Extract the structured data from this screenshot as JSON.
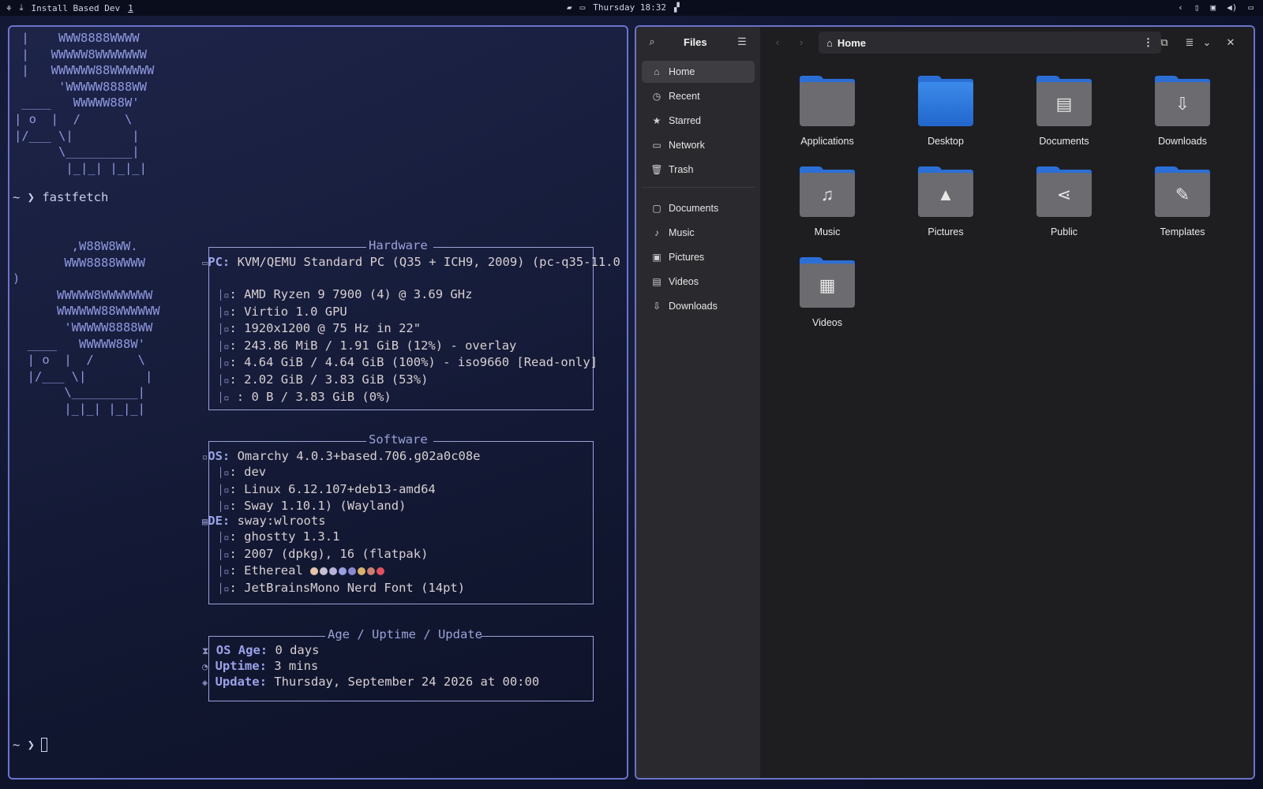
{
  "topbar": {
    "app_title": "Install Based Dev",
    "workspace": "1",
    "clock": "Thursday 18:32"
  },
  "terminal": {
    "top_logo": [
      " |    WWW8888WWWW",
      " |   WWWWW8WWWWWWW",
      " |   WWWWWW88WWWWWW",
      "      'WWWWW8888WW",
      " ____   WWWWW88W'",
      "| o  |  /      \\",
      "|/___ \\|        |",
      "      \\_________|",
      "       |_|_| |_|_|"
    ],
    "prompt_symbol": "~ ❯",
    "command": "fastfetch",
    "logo": [
      "        ,W88W8WW.",
      "       WWW8888WWWW",
      ")",
      "      WWWWW8WWWWWWW",
      "      WWWWWW88WWWWWW",
      "       'WWWWW8888WW",
      "  ____   WWWWW88W'",
      "  | o  |  /      \\",
      "  |/___ \\|        |",
      "       \\_________|",
      "       |_|_| |_|_|"
    ],
    "hardware": {
      "title": "Hardware",
      "pc_key": "PC:",
      "pc_value": " KVM/QEMU Standard PC (Q35 + ICH9, 2009) (pc-q35-11.0",
      "lines": [
        ": AMD Ryzen 9 7900 (4) @ 3.69 GHz",
        ": Virtio 1.0 GPU",
        ": 1920x1200 @ 75 Hz in 22\"",
        ": 243.86 MiB / 1.91 GiB (12%) - overlay",
        ": 4.64 GiB / 4.64 GiB (100%) - iso9660 [Read-only]",
        ": 2.02 GiB / 3.83 GiB (53%)",
        " : 0 B / 3.83 GiB (0%)"
      ]
    },
    "software": {
      "title": "Software",
      "os_key": "OS:",
      "os_value": " Omarchy 4.0.3+based.706.g02a0c08e",
      "lines_a": [
        ": dev",
        ": Linux 6.12.107+deb13-amd64",
        ": Sway 1.10.1) (Wayland)"
      ],
      "de_key": "DE:",
      "de_value": " sway:wlroots",
      "lines_b": [
        ": ghostty 1.3.1",
        ": 2007 (dpkg), 16 (flatpak)",
        ": Ethereal ",
        ": JetBrainsMono Nerd Font (14pt)"
      ],
      "palette": [
        "#e7c3a8",
        "#c7c0d0",
        "#b9b3d8",
        "#9a9fe0",
        "#8b88d0",
        "#d9b36a",
        "#c98070",
        "#e05060"
      ]
    },
    "age": {
      "title": "Age / Uptime / Update",
      "os_age_key": "OS Age:",
      "os_age_value": " 0 days",
      "uptime_key": "Uptime:",
      "uptime_value": " 3 mins",
      "update_key": "Update:",
      "update_value": " Thursday, September 24 2026 at 00:00"
    }
  },
  "files": {
    "sidebar_title": "Files",
    "sidebar_top": [
      {
        "label": "Home",
        "icon": "home-icon"
      },
      {
        "label": "Recent",
        "icon": "clock-icon"
      },
      {
        "label": "Starred",
        "icon": "star-icon"
      },
      {
        "label": "Network",
        "icon": "network-icon"
      },
      {
        "label": "Trash",
        "icon": "trash-icon"
      }
    ],
    "sidebar_places": [
      {
        "label": "Documents",
        "icon": "document-icon"
      },
      {
        "label": "Music",
        "icon": "music-icon"
      },
      {
        "label": "Pictures",
        "icon": "picture-icon"
      },
      {
        "label": "Videos",
        "icon": "video-icon"
      },
      {
        "label": "Downloads",
        "icon": "download-icon"
      }
    ],
    "path": "Home",
    "folders": [
      {
        "label": "Applications",
        "glyph": ""
      },
      {
        "label": "Desktop",
        "glyph": ""
      },
      {
        "label": "Documents",
        "glyph": "▤"
      },
      {
        "label": "Downloads",
        "glyph": "⇩"
      },
      {
        "label": "Music",
        "glyph": "♫"
      },
      {
        "label": "Pictures",
        "glyph": "▲"
      },
      {
        "label": "Public",
        "glyph": "⋖"
      },
      {
        "label": "Templates",
        "glyph": "✎"
      },
      {
        "label": "Videos",
        "glyph": "▦"
      }
    ]
  }
}
